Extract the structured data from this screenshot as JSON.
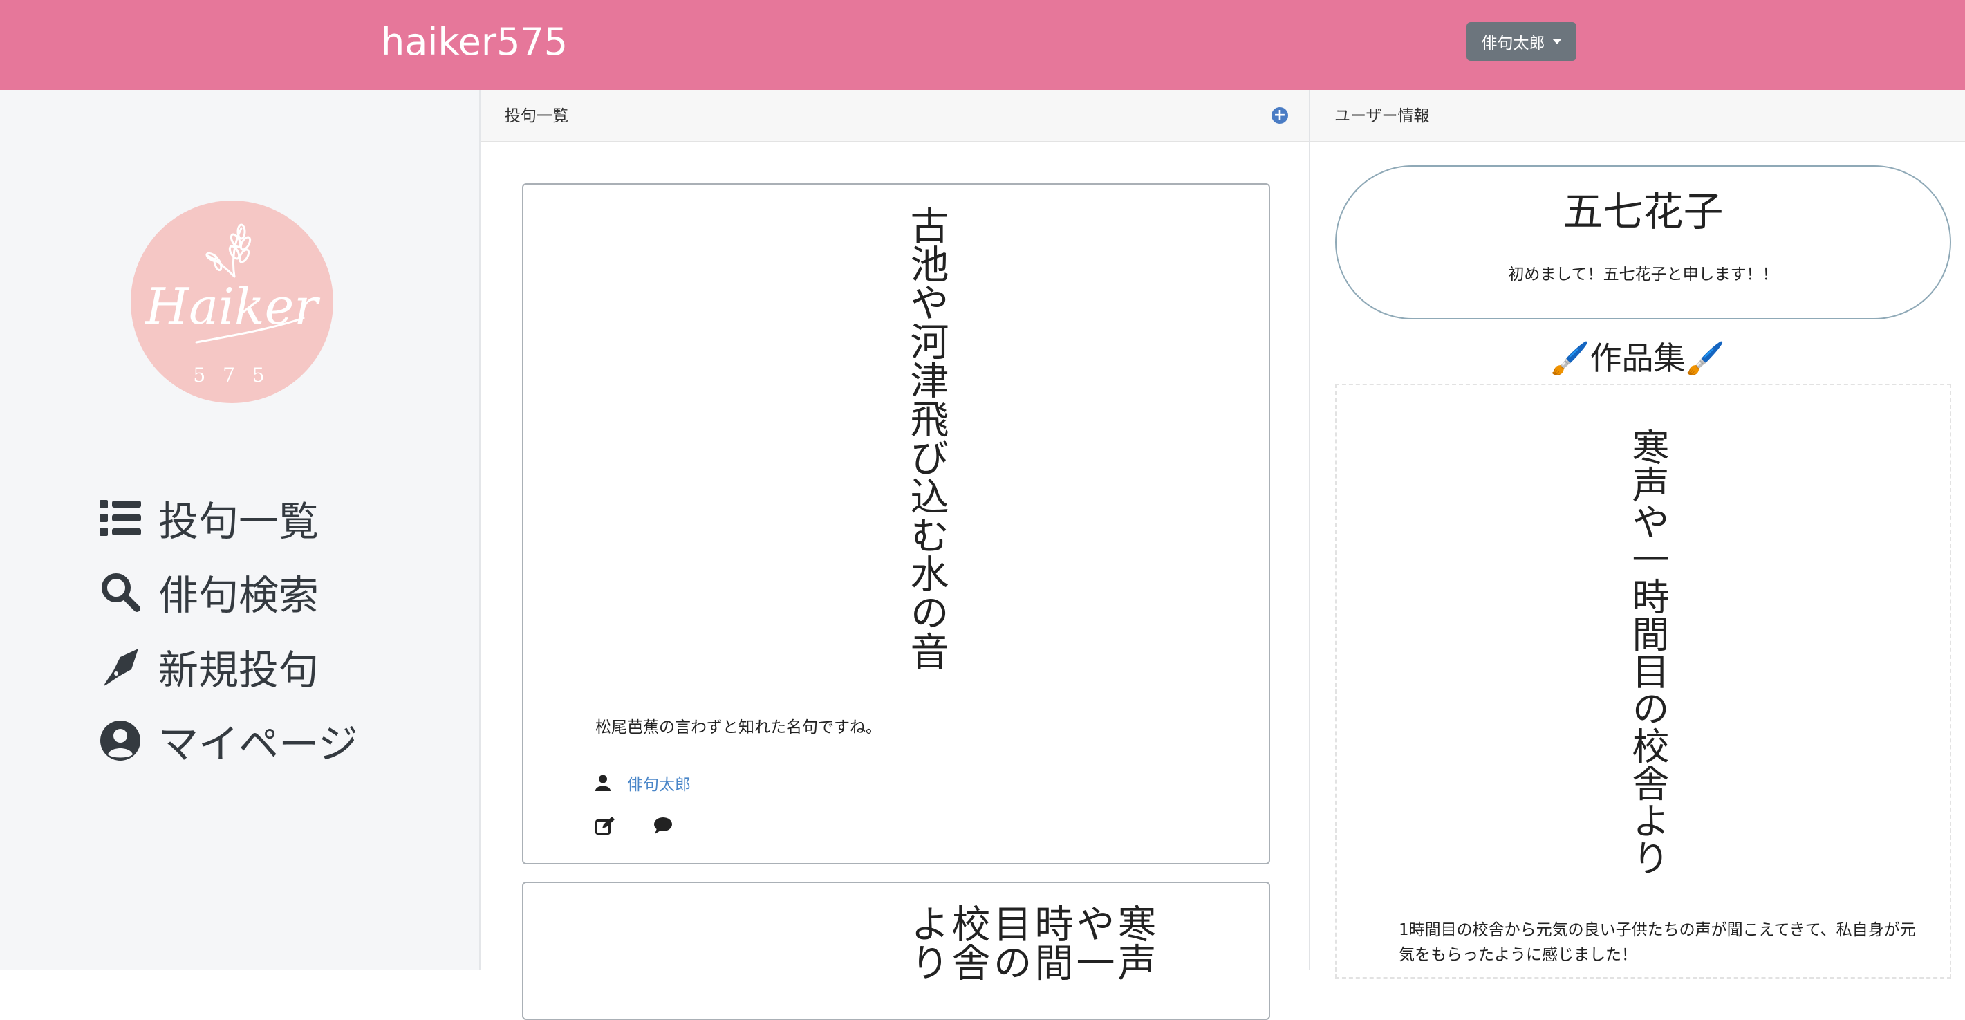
{
  "navbar": {
    "brand": "haiker575",
    "user_menu_label": "俳句太郎"
  },
  "sidebar": {
    "logo_text": "Haiker",
    "logo_numbers": "5 7 5",
    "items": [
      {
        "label": "投句一覧",
        "icon": "list-icon"
      },
      {
        "label": "俳句検索",
        "icon": "search-icon"
      },
      {
        "label": "新規投句",
        "icon": "pen-icon"
      },
      {
        "label": "マイページ",
        "icon": "user-circle-icon"
      }
    ]
  },
  "posts_panel": {
    "header": "投句一覧",
    "posts": [
      {
        "haiku": "古池や河津飛び込む水の音",
        "comment": "松尾芭蕉の言わずと知れた名句ですね。",
        "author": "俳句太郎"
      },
      {
        "haiku": "寒声や一時間目の校舎より"
      }
    ]
  },
  "user_panel": {
    "header": "ユーザー情報",
    "name": "五七花子",
    "bio": "初めまして！五七花子と申します！！",
    "works_title": "🖌️作品集🖌️",
    "works": [
      {
        "haiku": "寒声や一時間目の校舎より",
        "comment": "1時間目の校舎から元気の良い子供たちの声が聞こえてきて、私自身が元気をもらったように感じました！"
      }
    ]
  },
  "colors": {
    "navbar": "#e6779a",
    "sidebar_bg": "#f5f6f8",
    "logo_bg": "#f5c7c5",
    "link": "#4a86c8",
    "dropdown_bg": "#6c757d"
  }
}
